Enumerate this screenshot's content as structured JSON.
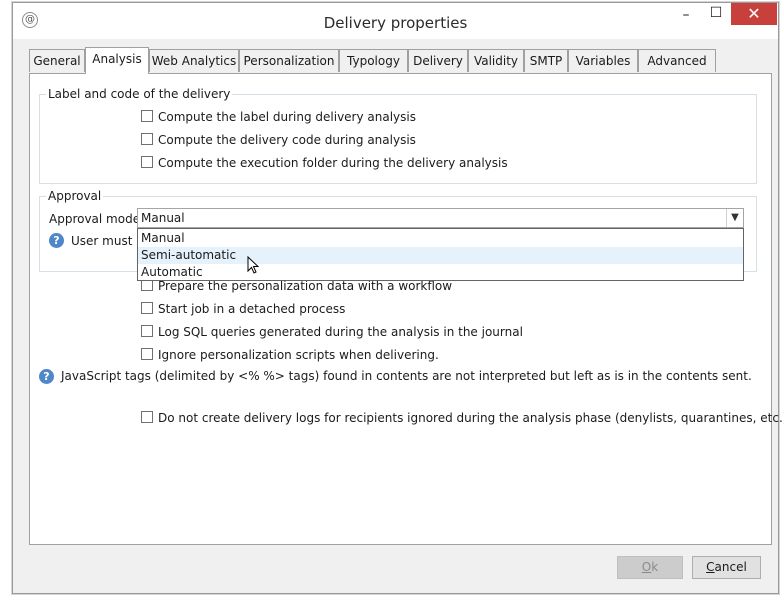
{
  "window": {
    "title": "Delivery properties",
    "icon": "app-icon",
    "controls": {
      "minimize": "–",
      "maximize": "☐",
      "close": "✕"
    }
  },
  "tabs": [
    {
      "label": "General"
    },
    {
      "label": "Analysis",
      "active": true
    },
    {
      "label": "Web Analytics"
    },
    {
      "label": "Personalization"
    },
    {
      "label": "Typology"
    },
    {
      "label": "Delivery"
    },
    {
      "label": "Validity"
    },
    {
      "label": "SMTP"
    },
    {
      "label": "Variables"
    },
    {
      "label": "Advanced"
    }
  ],
  "label_group": {
    "legend": "Label and code of the delivery",
    "options": [
      {
        "label": "Compute the label during delivery analysis",
        "checked": false
      },
      {
        "label": "Compute the delivery code during analysis",
        "checked": false
      },
      {
        "label": "Compute the execution folder during the delivery analysis",
        "checked": false
      }
    ]
  },
  "approval": {
    "legend": "Approval",
    "mode_label": "Approval mode:",
    "mode_value": "Manual",
    "note": "User must ap",
    "dropdown_options": [
      "Manual",
      "Semi-automatic",
      "Automatic"
    ],
    "hovered_option": "Semi-automatic"
  },
  "options": [
    {
      "label": "Prepare the personalization data with a workflow",
      "checked": false
    },
    {
      "label": "Start job in a detached process",
      "checked": false
    },
    {
      "label": "Log SQL queries generated during the analysis in the journal",
      "checked": false
    },
    {
      "label": "Ignore personalization scripts when delivering.",
      "checked": false
    }
  ],
  "js_note": "JavaScript tags (delimited by <% %> tags) found in contents are not interpreted but left as is in the contents sent.",
  "logs_option": {
    "label": "Do not create delivery logs for recipients ignored during the analysis phase (denylists, quarantines, etc.)",
    "checked": false
  },
  "buttons": {
    "ok": {
      "label": "Ok",
      "mnemonic": "O",
      "rest": "k",
      "enabled": false
    },
    "cancel": {
      "label": "Cancel",
      "mnemonic": "C",
      "rest": "ancel",
      "enabled": true
    }
  },
  "colors": {
    "close_button": "#c7403b",
    "help_icon": "#4f87c9",
    "dropdown_hover": "#e5f1fb"
  }
}
